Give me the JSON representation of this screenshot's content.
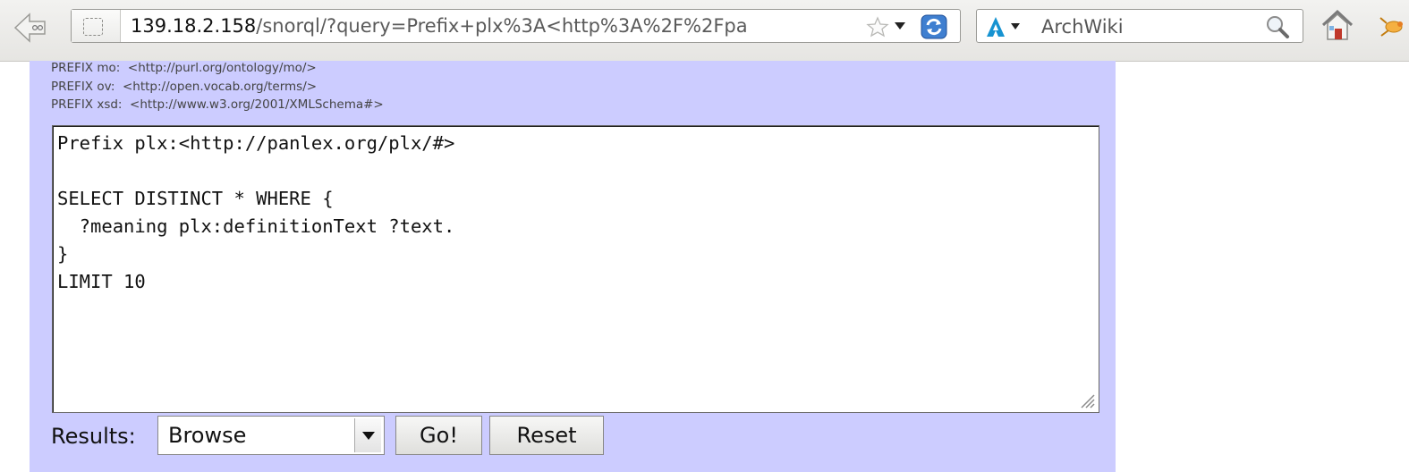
{
  "browser": {
    "url_host": "139.18.2.158",
    "url_path": "/snorql/?query=Prefix+plx%3A<http%3A%2F%2Fpa",
    "search_engine": "ArchWiki",
    "icons": [
      "back-icon",
      "site-identity-icon",
      "bookmark-star-icon",
      "url-history-dropdown-icon",
      "reload-icon",
      "search-engine-icon",
      "search-icon",
      "home-icon",
      "addon-icon"
    ]
  },
  "page": {
    "prefixes": [
      "PREFIX mo:  <http://purl.org/ontology/mo/>",
      "PREFIX ov:  <http://open.vocab.org/terms/>",
      "PREFIX xsd:  <http://www.w3.org/2001/XMLSchema#>"
    ],
    "query": "Prefix plx:<http://panlex.org/plx/#>\n\nSELECT DISTINCT * WHERE {\n  ?meaning plx:definitionText ?text.\n}\nLIMIT 10",
    "results_label": "Results:",
    "results_selected": "Browse",
    "go_label": "Go!",
    "reset_label": "Reset",
    "panel_color": "#ccccff"
  }
}
